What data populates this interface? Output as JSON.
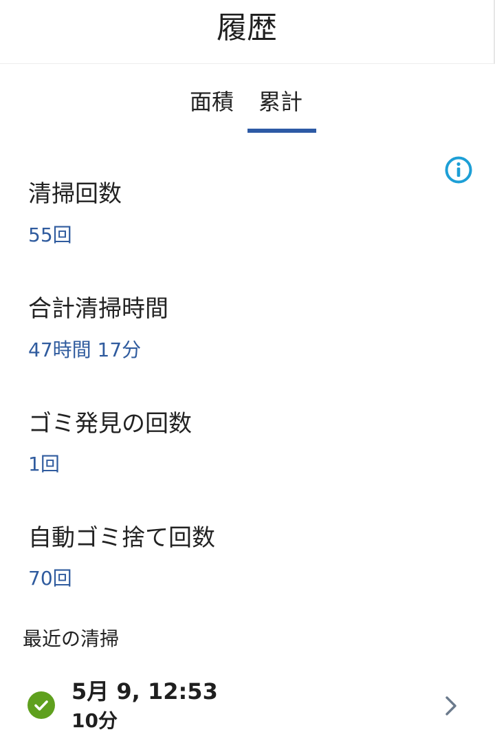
{
  "header": {
    "title": "履歴"
  },
  "tabs": [
    {
      "label": "面積",
      "selected": false
    },
    {
      "label": "累計",
      "selected": true
    }
  ],
  "accent_color": "#2d5aa5",
  "value_color": "#2f5b9e",
  "info_icon": {
    "name": "info-icon",
    "color": "#1d9fd6"
  },
  "stats": [
    {
      "label": "清掃回数",
      "value": "55回"
    },
    {
      "label": "合計清掃時間",
      "value": "47時間 17分"
    },
    {
      "label": "ゴミ発見の回数",
      "value": "1回"
    },
    {
      "label": "自動ゴミ捨て回数",
      "value": "70回"
    }
  ],
  "recent": {
    "title": "最近の清掃",
    "items": [
      {
        "datetime": "5月 9, 12:53",
        "duration": "10分",
        "status_icon": "check-circle-icon",
        "status_color": "#5fa01e",
        "chevron": "chevron-right-icon"
      }
    ]
  }
}
